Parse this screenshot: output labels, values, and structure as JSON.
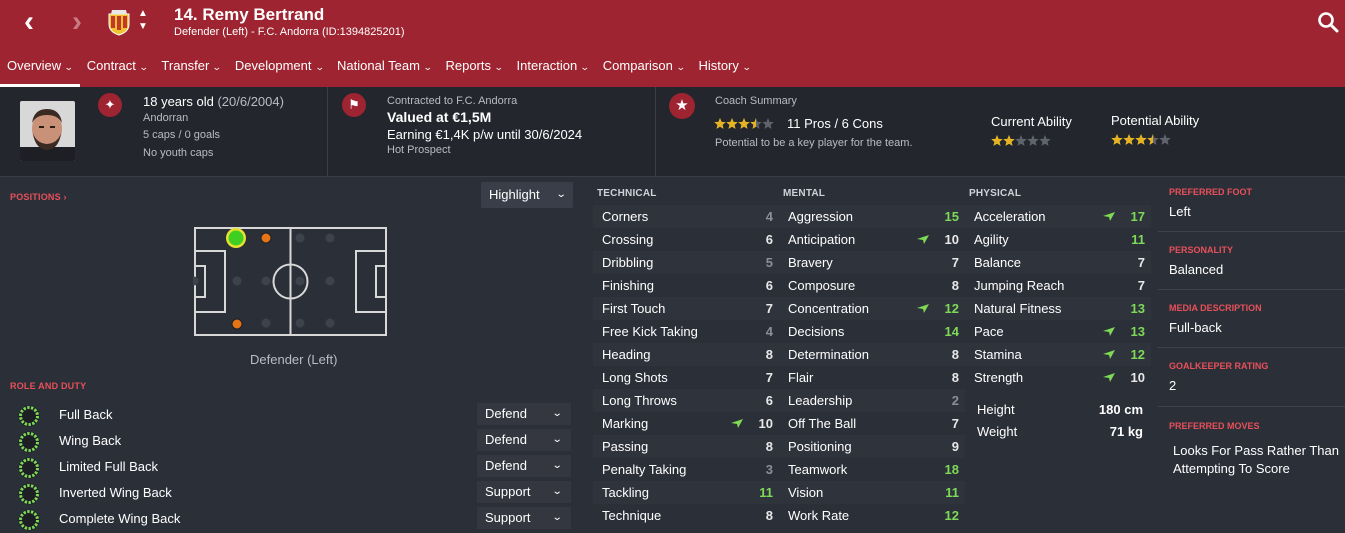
{
  "header": {
    "title": "14. Remy Bertrand",
    "subtitle": "Defender (Left) - F.C. Andorra (ID:1394825201)"
  },
  "tabs": [
    {
      "label": "Overview"
    },
    {
      "label": "Contract"
    },
    {
      "label": "Transfer"
    },
    {
      "label": "Development"
    },
    {
      "label": "National Team"
    },
    {
      "label": "Reports"
    },
    {
      "label": "Interaction"
    },
    {
      "label": "Comparison"
    },
    {
      "label": "History"
    }
  ],
  "info": {
    "age": "18 years old",
    "dob": "(20/6/2004)",
    "nationality": "Andorran",
    "caps": "5 caps / 0 goals",
    "youth_caps": "No youth caps",
    "contracted": "Contracted to F.C. Andorra",
    "value": "Valued at €1,5M",
    "earning": "Earning €1,4K p/w until 30/6/2024",
    "status": "Hot Prospect",
    "coach_label": "Coach Summary",
    "pros_cons": "11 Pros / 6 Cons",
    "coach_text": "Potential to be a key player for the team.",
    "coach_stars": 3.5,
    "ca_label": "Current Ability",
    "ca_stars": 2,
    "pa_label": "Potential Ability",
    "pa_stars": 3.5
  },
  "positions": {
    "label": "POSITIONS",
    "highlight": "Highlight",
    "position_text": "Defender (Left)"
  },
  "roles": {
    "label": "ROLE AND DUTY",
    "items": [
      {
        "name": "Full Back",
        "duty": "Defend"
      },
      {
        "name": "Wing Back",
        "duty": "Defend"
      },
      {
        "name": "Limited Full Back",
        "duty": "Defend"
      },
      {
        "name": "Inverted Wing Back",
        "duty": "Support"
      },
      {
        "name": "Complete Wing Back",
        "duty": "Support"
      }
    ]
  },
  "attributes": {
    "technical": {
      "label": "TECHNICAL",
      "items": [
        {
          "name": "Corners",
          "value": "4"
        },
        {
          "name": "Crossing",
          "value": "6"
        },
        {
          "name": "Dribbling",
          "value": "5"
        },
        {
          "name": "Finishing",
          "value": "6"
        },
        {
          "name": "First Touch",
          "value": "7"
        },
        {
          "name": "Free Kick Taking",
          "value": "4"
        },
        {
          "name": "Heading",
          "value": "8"
        },
        {
          "name": "Long Shots",
          "value": "7"
        },
        {
          "name": "Long Throws",
          "value": "6"
        },
        {
          "name": "Marking",
          "value": "10",
          "up": true
        },
        {
          "name": "Passing",
          "value": "8"
        },
        {
          "name": "Penalty Taking",
          "value": "3"
        },
        {
          "name": "Tackling",
          "value": "11"
        },
        {
          "name": "Technique",
          "value": "8"
        }
      ]
    },
    "mental": {
      "label": "MENTAL",
      "items": [
        {
          "name": "Aggression",
          "value": "15"
        },
        {
          "name": "Anticipation",
          "value": "10",
          "up": true
        },
        {
          "name": "Bravery",
          "value": "7"
        },
        {
          "name": "Composure",
          "value": "8"
        },
        {
          "name": "Concentration",
          "value": "12",
          "up": true
        },
        {
          "name": "Decisions",
          "value": "14"
        },
        {
          "name": "Determination",
          "value": "8"
        },
        {
          "name": "Flair",
          "value": "8"
        },
        {
          "name": "Leadership",
          "value": "2"
        },
        {
          "name": "Off The Ball",
          "value": "7"
        },
        {
          "name": "Positioning",
          "value": "9"
        },
        {
          "name": "Teamwork",
          "value": "18"
        },
        {
          "name": "Vision",
          "value": "11"
        },
        {
          "name": "Work Rate",
          "value": "12"
        }
      ]
    },
    "physical": {
      "label": "PHYSICAL",
      "items": [
        {
          "name": "Acceleration",
          "value": "17",
          "up": true
        },
        {
          "name": "Agility",
          "value": "11"
        },
        {
          "name": "Balance",
          "value": "7"
        },
        {
          "name": "Jumping Reach",
          "value": "7"
        },
        {
          "name": "Natural Fitness",
          "value": "13"
        },
        {
          "name": "Pace",
          "value": "13",
          "up": true
        },
        {
          "name": "Stamina",
          "value": "12",
          "up": true
        },
        {
          "name": "Strength",
          "value": "10",
          "up": true
        }
      ],
      "height_label": "Height",
      "height": "180 cm",
      "weight_label": "Weight",
      "weight": "71 kg"
    }
  },
  "details": {
    "foot_label": "PREFERRED FOOT",
    "foot": "Left",
    "personality_label": "PERSONALITY",
    "personality": "Balanced",
    "media_label": "MEDIA DESCRIPTION",
    "media": "Full-back",
    "gk_label": "GOALKEEPER RATING",
    "gk": "2",
    "moves_label": "PREFERRED MOVES",
    "move_1": "Looks For Pass Rather Than",
    "move_2": "Attempting To Score"
  },
  "colors": {
    "brand": "#9d2430",
    "panel": "#2b2f38",
    "value_low": "#8c8f96",
    "value_mid": "#e8e8e8",
    "value_high": "#7ed957",
    "star": "#e6b422"
  }
}
